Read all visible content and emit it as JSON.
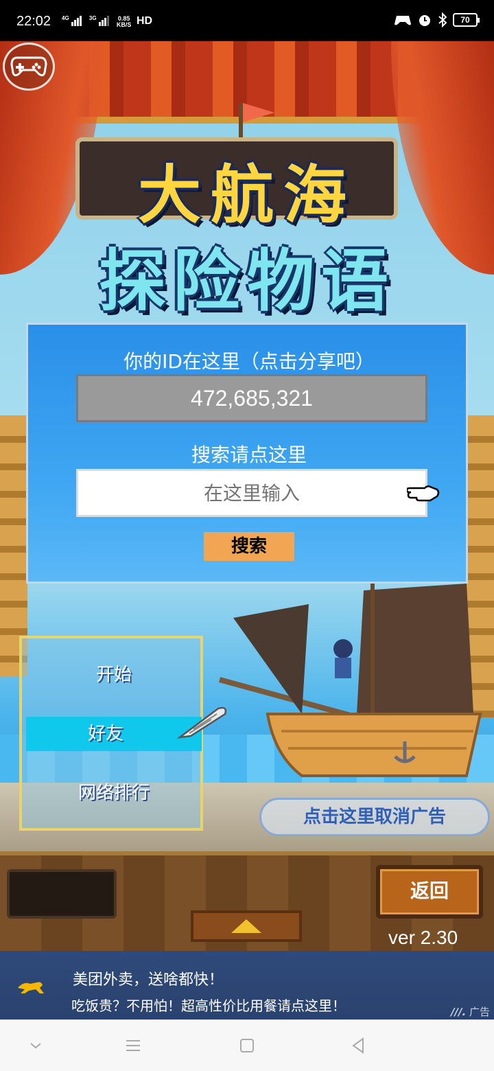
{
  "status_bar": {
    "time": "22:02",
    "net1": "4G",
    "net2": "3G",
    "speed_value": "0.85",
    "speed_unit": "KB/S",
    "hd": "HD",
    "battery": "70"
  },
  "game": {
    "title_line1": "大航海",
    "title_line2": "探险物语",
    "id_caption": "你的ID在这里（点击分享吧）",
    "player_id": "472,685,321",
    "search_caption": "搜索请点这里",
    "search_placeholder": "在这里输入",
    "search_button": "搜索",
    "menu": {
      "start": "开始",
      "friends": "好友",
      "ranking": "网络排行"
    },
    "cancel_ad": "点击这里取消广告",
    "back_button": "返回",
    "version": "ver 2.30"
  },
  "ad": {
    "line1": "美团外卖，送啥都快！",
    "line2": "吃饭贵？不用怕！超高性价比用餐请点这里！",
    "tag": "广告"
  },
  "colors": {
    "panel_blue": "#3ea6f2",
    "search_button": "#f2a654",
    "menu_highlight": "#10c8ec",
    "ad_banner": "#2f4a7a"
  },
  "icons": [
    "gamepad-icon",
    "pointing-hand-icon",
    "wing-cursor-icon",
    "up-arrow-icon",
    "meituan-kangaroo-icon",
    "alarm-icon",
    "bluetooth-icon",
    "battery-icon"
  ]
}
